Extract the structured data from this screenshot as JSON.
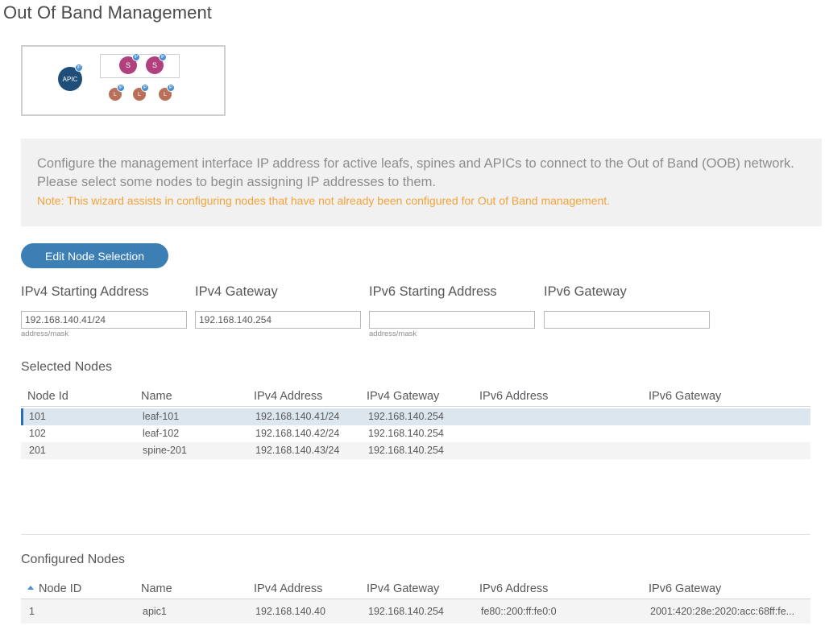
{
  "page_title": "Out Of Band Management",
  "topology": {
    "apic_label": "APIC",
    "spine_label": "S",
    "leaf_label": "L",
    "ip_badge": "IP"
  },
  "info": {
    "text": "Configure the management interface IP address for active leafs, spines and APICs to connect to the Out of Band (OOB) network. Please select some nodes to begin assigning IP addresses to them.",
    "note": "Note: This wizard assists in configuring nodes that have not already been configured for Out of Band management."
  },
  "edit_button_label": "Edit Node Selection",
  "fields": {
    "ipv4_start": {
      "label": "IPv4 Starting Address",
      "value": "192.168.140.41/24",
      "hint": "address/mask"
    },
    "ipv4_gateway": {
      "label": "IPv4 Gateway",
      "value": "192.168.140.254"
    },
    "ipv6_start": {
      "label": "IPv6 Starting Address",
      "value": "",
      "hint": "address/mask"
    },
    "ipv6_gateway": {
      "label": "IPv6 Gateway",
      "value": ""
    }
  },
  "selected_nodes": {
    "title": "Selected Nodes",
    "columns": [
      "Node Id",
      "Name",
      "IPv4 Address",
      "IPv4 Gateway",
      "IPv6 Address",
      "IPv6 Gateway"
    ],
    "rows": [
      [
        "101",
        "leaf-101",
        "192.168.140.41/24",
        "192.168.140.254",
        "",
        ""
      ],
      [
        "102",
        "leaf-102",
        "192.168.140.42/24",
        "192.168.140.254",
        "",
        ""
      ],
      [
        "201",
        "spine-201",
        "192.168.140.43/24",
        "192.168.140.254",
        "",
        ""
      ]
    ]
  },
  "configured_nodes": {
    "title": "Configured Nodes",
    "columns": [
      "Node ID",
      "Name",
      "IPv4 Address",
      "IPv4 Gateway",
      "IPv6 Address",
      "IPv6 Gateway"
    ],
    "rows": [
      [
        "1",
        "apic1",
        "192.168.140.40",
        "192.168.140.254",
        "fe80::200:ff:fe0:0",
        "2001:420:28e:2020:acc:68ff:fe..."
      ]
    ]
  }
}
